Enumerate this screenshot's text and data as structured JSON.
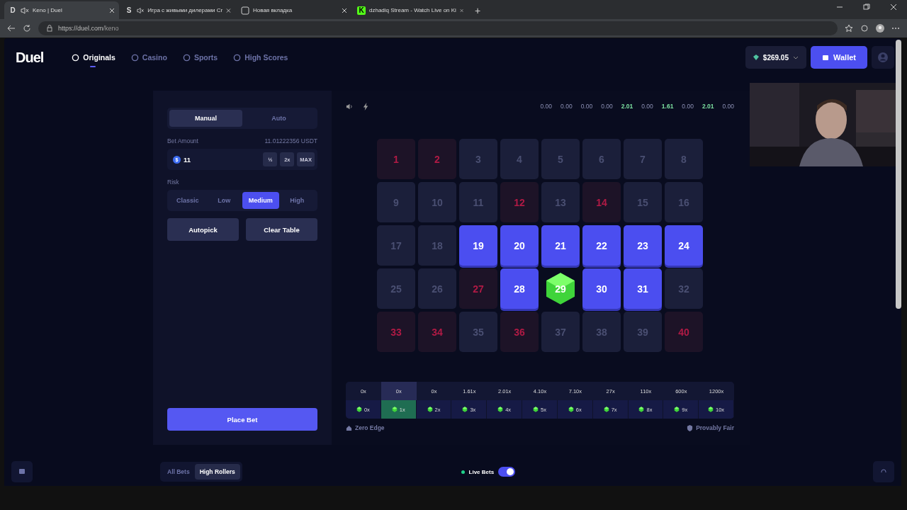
{
  "browser": {
    "tabs": [
      {
        "icon": "D",
        "title": "Keno | Duel",
        "muted": true,
        "selected": true
      },
      {
        "icon": "S",
        "title": "Игра с живыми дилерами Cr",
        "muted": true,
        "selected": false
      },
      {
        "title": "Новая вкладка",
        "muted": false,
        "selected": false
      },
      {
        "icon": "K",
        "title": "dzhadiq Stream - Watch Live on Ki",
        "muted": false,
        "selected": false
      }
    ],
    "new_tab": "+",
    "url_host": "https://duel.com",
    "url_path": "/keno"
  },
  "header": {
    "logo": "Duel",
    "nav": [
      {
        "label": "Originals",
        "selected": true
      },
      {
        "label": "Casino",
        "selected": false
      },
      {
        "label": "Sports",
        "selected": false
      },
      {
        "label": "High Scores",
        "selected": false
      }
    ],
    "balance": "$269.05",
    "wallet": "Wallet"
  },
  "bet_panel": {
    "modes": [
      {
        "label": "Manual",
        "selected": true
      },
      {
        "label": "Auto",
        "selected": false
      }
    ],
    "bet_amount_label": "Bet Amount",
    "bet_amount_conversion": "11.01222356 USDT",
    "coin": "$",
    "bet_value": "11",
    "amount_buttons": [
      "½",
      "2x",
      "MAX"
    ],
    "risk_label": "Risk",
    "risk": [
      {
        "label": "Classic",
        "selected": false
      },
      {
        "label": "Low",
        "selected": false
      },
      {
        "label": "Medium",
        "selected": true
      },
      {
        "label": "High",
        "selected": false
      }
    ],
    "actions": [
      "Autopick",
      "Clear Table"
    ],
    "place_bet": "Place Bet"
  },
  "history": [
    {
      "value": "0.00",
      "win": false
    },
    {
      "value": "0.00",
      "win": false
    },
    {
      "value": "0.00",
      "win": false
    },
    {
      "value": "0.00",
      "win": false
    },
    {
      "value": "2.01",
      "win": true
    },
    {
      "value": "0.00",
      "win": false
    },
    {
      "value": "1.61",
      "win": true
    },
    {
      "value": "0.00",
      "win": false
    },
    {
      "value": "2.01",
      "win": true
    },
    {
      "value": "0.00",
      "win": false
    }
  ],
  "tiles": [
    {
      "n": "1",
      "kind": "drawn"
    },
    {
      "n": "2",
      "kind": "drawn"
    },
    {
      "n": "3",
      "kind": "idle"
    },
    {
      "n": "4",
      "kind": "idle"
    },
    {
      "n": "5",
      "kind": "idle"
    },
    {
      "n": "6",
      "kind": "idle"
    },
    {
      "n": "7",
      "kind": "idle"
    },
    {
      "n": "8",
      "kind": "idle"
    },
    {
      "n": "9",
      "kind": "idle"
    },
    {
      "n": "10",
      "kind": "idle"
    },
    {
      "n": "11",
      "kind": "idle"
    },
    {
      "n": "12",
      "kind": "drawn"
    },
    {
      "n": "13",
      "kind": "idle"
    },
    {
      "n": "14",
      "kind": "drawn"
    },
    {
      "n": "15",
      "kind": "idle"
    },
    {
      "n": "16",
      "kind": "idle"
    },
    {
      "n": "17",
      "kind": "idle"
    },
    {
      "n": "18",
      "kind": "idle"
    },
    {
      "n": "19",
      "kind": "picked"
    },
    {
      "n": "20",
      "kind": "picked"
    },
    {
      "n": "21",
      "kind": "picked"
    },
    {
      "n": "22",
      "kind": "picked"
    },
    {
      "n": "23",
      "kind": "picked"
    },
    {
      "n": "24",
      "kind": "picked"
    },
    {
      "n": "25",
      "kind": "idle"
    },
    {
      "n": "26",
      "kind": "idle"
    },
    {
      "n": "27",
      "kind": "drawn"
    },
    {
      "n": "28",
      "kind": "picked"
    },
    {
      "n": "29",
      "kind": "hit"
    },
    {
      "n": "30",
      "kind": "picked"
    },
    {
      "n": "31",
      "kind": "picked"
    },
    {
      "n": "32",
      "kind": "idle"
    },
    {
      "n": "33",
      "kind": "drawn"
    },
    {
      "n": "34",
      "kind": "drawn"
    },
    {
      "n": "35",
      "kind": "idle"
    },
    {
      "n": "36",
      "kind": "drawn"
    },
    {
      "n": "37",
      "kind": "idle"
    },
    {
      "n": "38",
      "kind": "idle"
    },
    {
      "n": "39",
      "kind": "idle"
    },
    {
      "n": "40",
      "kind": "drawn"
    }
  ],
  "payouts": [
    {
      "multiplier": "0x",
      "hits": "0x",
      "selected": false
    },
    {
      "multiplier": "0x",
      "hits": "1x",
      "selected": true
    },
    {
      "multiplier": "0x",
      "hits": "2x",
      "selected": false
    },
    {
      "multiplier": "1.61x",
      "hits": "3x",
      "selected": false
    },
    {
      "multiplier": "2.01x",
      "hits": "4x",
      "selected": false
    },
    {
      "multiplier": "4.10x",
      "hits": "5x",
      "selected": false
    },
    {
      "multiplier": "7.10x",
      "hits": "6x",
      "selected": false
    },
    {
      "multiplier": "27x",
      "hits": "7x",
      "selected": false
    },
    {
      "multiplier": "110x",
      "hits": "8x",
      "selected": false
    },
    {
      "multiplier": "600x",
      "hits": "9x",
      "selected": false
    },
    {
      "multiplier": "1200x",
      "hits": "10x",
      "selected": false
    }
  ],
  "footer_left": "Zero Edge",
  "footer_right": "Provably Fair",
  "bets_tabs": [
    {
      "label": "All Bets",
      "selected": false
    },
    {
      "label": "High Rollers",
      "selected": true
    }
  ],
  "live_bets": {
    "label": "Live Bets",
    "on": true
  }
}
